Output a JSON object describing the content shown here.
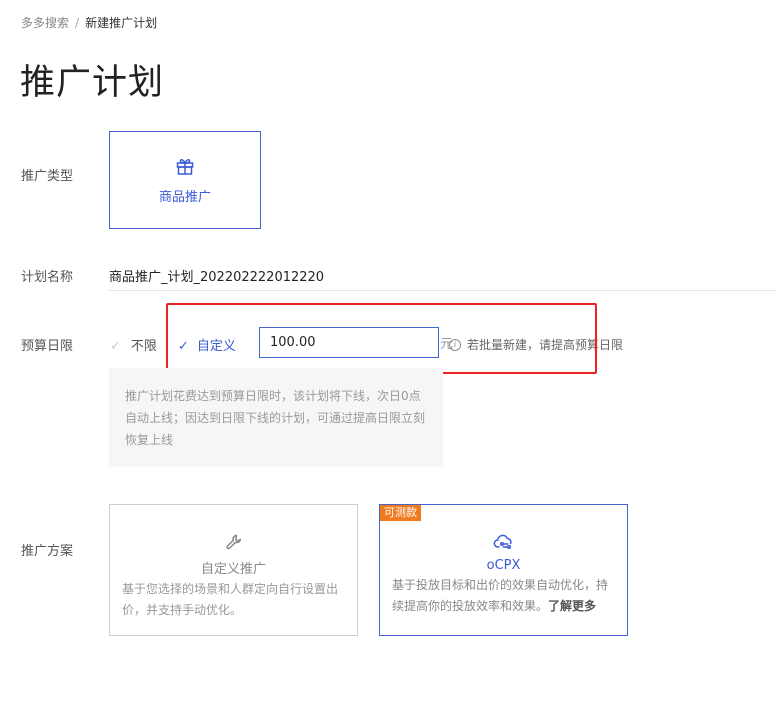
{
  "breadcrumb": {
    "parent": "多多搜索",
    "separator": "/",
    "current": "新建推广计划"
  },
  "page_title": "推广计划",
  "promo_type": {
    "label": "推广类型",
    "card_label": "商品推广",
    "icon": "gift-icon"
  },
  "plan_name": {
    "label": "计划名称",
    "value": "商品推广_计划_202202222012220"
  },
  "budget": {
    "label": "预算日限",
    "option_unlimited": "不限",
    "option_custom": "自定义",
    "selected": "自定义",
    "value": "100.00",
    "unit": "元",
    "hint": "若批量新建，请提高预算日限",
    "note_line1": "推广计划花费达到预算日限时，该计划将下线，次日0点",
    "note_line2": "自动上线；因达到日限下线的计划，可通过提高日限立刻",
    "note_line3": "恢复上线"
  },
  "scheme": {
    "label": "推广方案",
    "custom": {
      "title": "自定义推广",
      "desc_line1": "基于您选择的场景和人群定向自行设置出",
      "desc_line2": "价，并支持手动优化。",
      "icon": "wrench-icon"
    },
    "ocpx": {
      "badge": "可测款",
      "title": "oCPX",
      "desc_line1": "基于投放目标和出价的效果自动优化，持",
      "desc_line2": "续提高你的投放效率和效果。",
      "learn_more": "了解更多",
      "icon": "cloud-link-icon"
    }
  },
  "colors": {
    "accent": "#3a5ad8",
    "highlight": "#ee2222",
    "badge": "#f07a1e"
  }
}
